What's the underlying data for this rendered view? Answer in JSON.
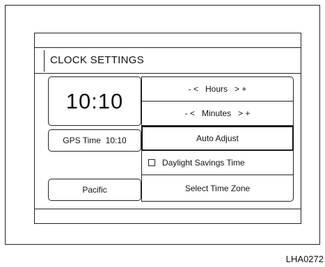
{
  "screen": {
    "title": "CLOCK SETTINGS",
    "clock_display": "10:10",
    "gps_time_label": "GPS Time  10:10",
    "hours_control": "- <   Hours   > +",
    "minutes_control": "- <   Minutes   > +",
    "auto_adjust_label": "Auto Adjust",
    "daylight_savings_label": "Daylight Savings Time",
    "daylight_savings_checked": false,
    "time_zone_value": "Pacific",
    "select_time_zone_label": "Select Time Zone"
  },
  "figure_code": "LHA0272"
}
